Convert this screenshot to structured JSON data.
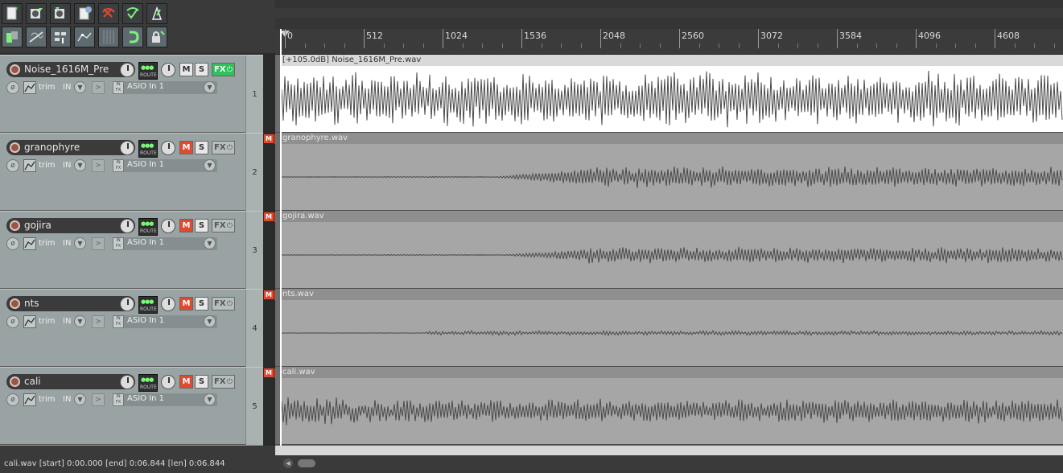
{
  "toolbar": {
    "buttons": [
      {
        "name": "new-project-icon"
      },
      {
        "name": "open-project-icon"
      },
      {
        "name": "save-project-icon"
      },
      {
        "name": "project-settings-icon"
      },
      {
        "name": "undo-icon"
      },
      {
        "name": "redo-icon"
      },
      {
        "name": "metronome-icon"
      },
      {
        "name": "auto-crossfade-icon"
      },
      {
        "name": "ripple-edit-icon"
      },
      {
        "name": "grouping-icon"
      },
      {
        "name": "envelope-points-icon"
      },
      {
        "name": "snap-grid-icon"
      },
      {
        "name": "snap-icon"
      },
      {
        "name": "lock-icon"
      }
    ]
  },
  "ruler": {
    "labels": [
      "0",
      "512",
      "1024",
      "1536",
      "2048",
      "2560",
      "3072",
      "3584",
      "4096",
      "4608"
    ]
  },
  "tracks": [
    {
      "number": "1",
      "name": "Noise_1616M_Pre",
      "mute_active": false,
      "fx_active": true,
      "trim": "trim",
      "in": "IN",
      "input": "ASIO In 1",
      "route": "ROUTE",
      "m": "M",
      "s": "S",
      "fx": "FX",
      "item_label": "[+105.0dB] Noise_1616M_Pre.wav",
      "selected": true,
      "meter_m": false
    },
    {
      "number": "2",
      "name": "granophyre",
      "mute_active": true,
      "fx_active": false,
      "trim": "trim",
      "in": "IN",
      "input": "ASIO In 1",
      "route": "ROUTE",
      "m": "M",
      "s": "S",
      "fx": "FX",
      "item_label": "granophyre.wav",
      "selected": false,
      "meter_m": true
    },
    {
      "number": "3",
      "name": "gojira",
      "mute_active": true,
      "fx_active": false,
      "trim": "trim",
      "in": "IN",
      "input": "ASIO In 1",
      "route": "ROUTE",
      "m": "M",
      "s": "S",
      "fx": "FX",
      "item_label": "gojira.wav",
      "selected": false,
      "meter_m": true
    },
    {
      "number": "4",
      "name": "nts",
      "mute_active": true,
      "fx_active": false,
      "trim": "trim",
      "in": "IN",
      "input": "ASIO In 1",
      "route": "ROUTE",
      "m": "M",
      "s": "S",
      "fx": "FX",
      "item_label": "nts.wav",
      "selected": false,
      "meter_m": true
    },
    {
      "number": "5",
      "name": "cali",
      "mute_active": true,
      "fx_active": false,
      "trim": "trim",
      "in": "IN",
      "input": "ASIO In 1",
      "route": "ROUTE",
      "m": "M",
      "s": "S",
      "fx": "FX",
      "item_label": "cali.wav",
      "selected": false,
      "meter_m": true
    }
  ],
  "status": {
    "text": "cali.wav [start] 0:00.000 [end] 0:06.844 [len] 0:06.844"
  },
  "colors": {
    "mute_active": "#e04a2f",
    "fx_active": "#2fc15a",
    "waveform": "#4a4a4a"
  }
}
